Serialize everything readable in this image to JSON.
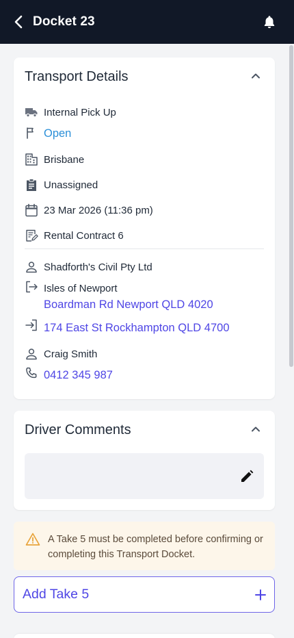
{
  "header": {
    "title": "Docket 23"
  },
  "transport": {
    "title": "Transport Details",
    "type": "Internal Pick Up",
    "status": "Open",
    "branch": "Brisbane",
    "assignment": "Unassigned",
    "datetime": "23 Mar 2026 (11:36 pm)",
    "contract": "Rental Contract 6",
    "customer": "Shadforth's Civil Pty Ltd",
    "from_name": "Isles of Newport",
    "from_address": "Boardman Rd Newport QLD 4020",
    "to_address": "174 East St Rockhampton QLD 4700",
    "contact_name": "Craig Smith",
    "contact_phone": "0412 345 987"
  },
  "driver_comments": {
    "title": "Driver Comments"
  },
  "warning": {
    "text": "A Take 5 must be completed before confirming or completing this Transport Docket."
  },
  "add_take5": {
    "label": "Add Take 5"
  },
  "colors": {
    "header_bg": "#111827",
    "link": "#4f46e5",
    "status_open": "#2b8fd8",
    "warning_bg": "#fdf6ea",
    "warning_icon": "#e8a33a"
  }
}
